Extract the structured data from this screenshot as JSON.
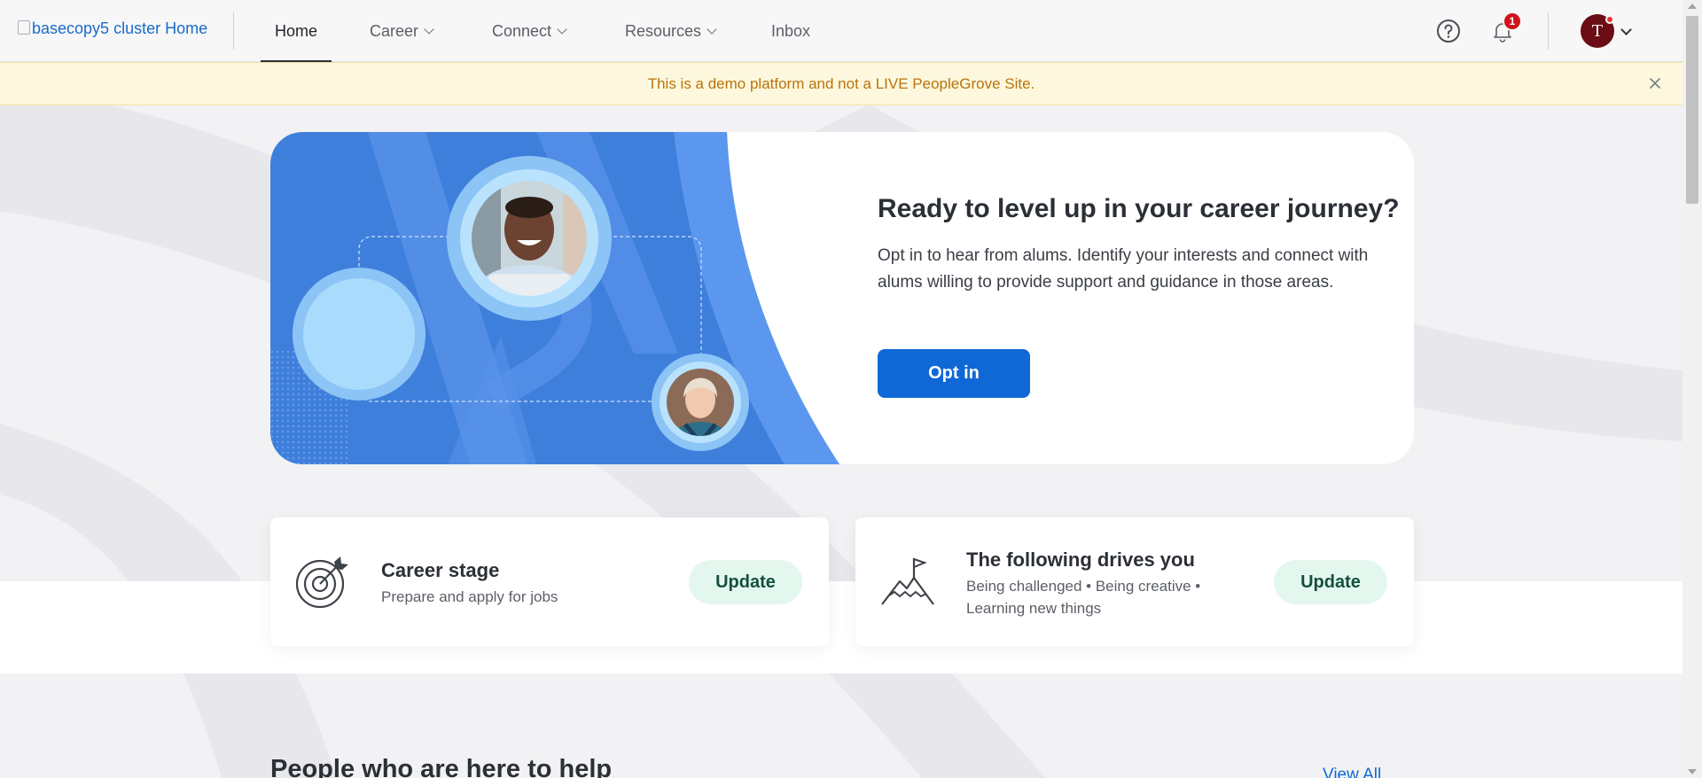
{
  "header": {
    "logo_alt": "basecopy5 cluster Home",
    "nav": [
      {
        "label": "Home",
        "active": true
      },
      {
        "label": "Career",
        "dropdown": true
      },
      {
        "label": "Connect",
        "dropdown": true
      },
      {
        "label": "Resources",
        "dropdown": true
      },
      {
        "label": "Inbox"
      }
    ],
    "notification_count": "1",
    "user_initial": "T",
    "icons": [
      "help-icon",
      "bell-icon",
      "chevron-down-icon"
    ]
  },
  "banner": {
    "text": "This is a demo platform and not a LIVE PeopleGrove Site."
  },
  "hero": {
    "title": "Ready to level up in your career journey?",
    "description": "Opt in to hear from alums. Identify your interests and connect with alums willing to provide support and guidance in those areas.",
    "button_label": "Opt in"
  },
  "cards": [
    {
      "title": "Career stage",
      "subtitle": "Prepare and apply for jobs",
      "button_label": "Update",
      "icon": "target-icon"
    },
    {
      "title": "The following drives you",
      "subtitle": "Being challenged • Being creative • Learning new things",
      "button_label": "Update",
      "icon": "mountain-flag-icon"
    }
  ],
  "section": {
    "title": "People who are here to help",
    "link": "View All"
  },
  "colors": {
    "primary": "#1068d6",
    "banner_text": "#b8730d",
    "banner_bg": "#fdf8dd",
    "update_bg": "#e4f7ee",
    "hero_blue": "#4a86e0"
  }
}
